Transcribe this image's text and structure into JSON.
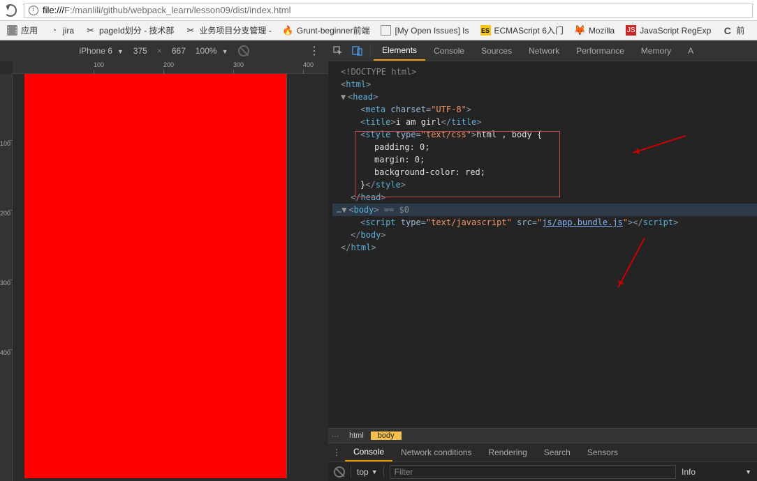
{
  "address": {
    "host": "file:///",
    "path": "F:/manlili/github/webpack_learn/lesson09/dist/index.html"
  },
  "bookmarks": [
    {
      "label": "应用",
      "icon": "apps"
    },
    {
      "label": "jira",
      "icon": "jira"
    },
    {
      "label": "pageId划分 - 技术部",
      "icon": "scissors"
    },
    {
      "label": "业务项目分支管理 - ",
      "icon": "scissors"
    },
    {
      "label": "Grunt-beginner前端",
      "icon": "flame"
    },
    {
      "label": "[My Open Issues] Is",
      "icon": "file"
    },
    {
      "label": "ECMAScript 6入门",
      "icon": "es"
    },
    {
      "label": "Mozilla",
      "icon": "moz"
    },
    {
      "label": "JavaScript RegExp",
      "icon": "reg"
    },
    {
      "label": "前",
      "icon": "c"
    }
  ],
  "device": {
    "name": "iPhone 6",
    "width": "375",
    "height": "667",
    "zoom": "100%"
  },
  "ruler": {
    "h": [
      "100",
      "200",
      "300",
      "400"
    ],
    "v": [
      "100",
      "200",
      "300",
      "400"
    ]
  },
  "devtools_tabs": [
    "Elements",
    "Console",
    "Sources",
    "Network",
    "Performance",
    "Memory",
    "A"
  ],
  "active_tab": "Elements",
  "dom": {
    "doctype": "<!DOCTYPE html>",
    "html_open": "<html>",
    "head_open": "<head>",
    "meta": {
      "tag": "meta",
      "attr": "charset",
      "val": "UTF-8"
    },
    "title": {
      "open": "<title>",
      "text": "i am girl",
      "close": "</title>"
    },
    "style": {
      "open_tag": "style",
      "type_attr": "type",
      "type_val": "text/css",
      "css": "html , body {\n        padding: 0;\n        margin: 0;\n        background-color: red;\n}"
    },
    "head_close": "</head>",
    "body_open": "<body>",
    "eqsel": " == $0",
    "script": {
      "tag": "script",
      "type_attr": "type",
      "type_val": "text/javascript",
      "src_attr": "src",
      "src_val": "js/app.bundle.js"
    },
    "body_close": "</body>",
    "html_close": "</html>"
  },
  "crumbs": [
    "html",
    "body"
  ],
  "drawer_tabs": [
    "Console",
    "Network conditions",
    "Rendering",
    "Search",
    "Sensors"
  ],
  "console": {
    "context": "top",
    "filter_ph": "Filter",
    "level": "Info"
  }
}
